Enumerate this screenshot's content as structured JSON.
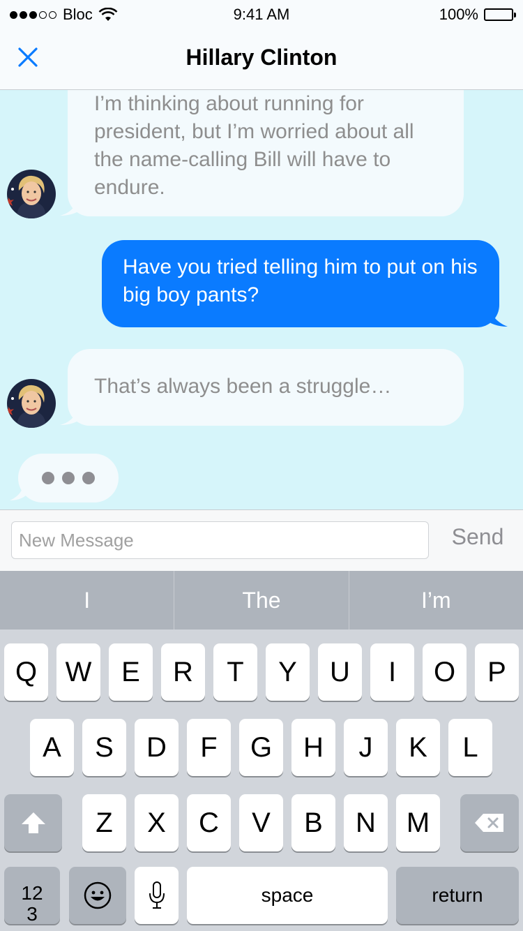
{
  "status_bar": {
    "carrier": "Bloc",
    "time": "9:41 AM",
    "battery": "100%"
  },
  "nav": {
    "title": "Hillary Clinton",
    "close_icon": "close-icon"
  },
  "messages": [
    {
      "direction": "incoming",
      "text": "I’m thinking about running for president, but I’m worried about all the name-calling Bill will have to endure."
    },
    {
      "direction": "outgoing",
      "text": "Have you tried telling him to put on his big boy pants?"
    },
    {
      "direction": "incoming",
      "text": "That’s always been a struggle…"
    }
  ],
  "typing_indicator": "typing-dots-icon",
  "composer": {
    "placeholder": "New Message",
    "value": "",
    "send_label": "Send"
  },
  "keyboard": {
    "suggestions": [
      "I",
      "The",
      "I’m"
    ],
    "row1": [
      "Q",
      "W",
      "E",
      "R",
      "T",
      "Y",
      "U",
      "I",
      "O",
      "P"
    ],
    "row2": [
      "A",
      "S",
      "D",
      "F",
      "G",
      "H",
      "J",
      "K",
      "L"
    ],
    "row3": [
      "Z",
      "X",
      "C",
      "V",
      "B",
      "N",
      "M"
    ],
    "numbers_label": "12\n3",
    "space_label": "space",
    "return_label": "return",
    "icons": [
      "shift-icon",
      "backspace-icon",
      "emoji-icon",
      "microphone-icon"
    ]
  },
  "colors": {
    "chat_background": "#d6f5fa",
    "outgoing_bubble": "#0a7bff",
    "incoming_bubble": "#f3fafd"
  }
}
